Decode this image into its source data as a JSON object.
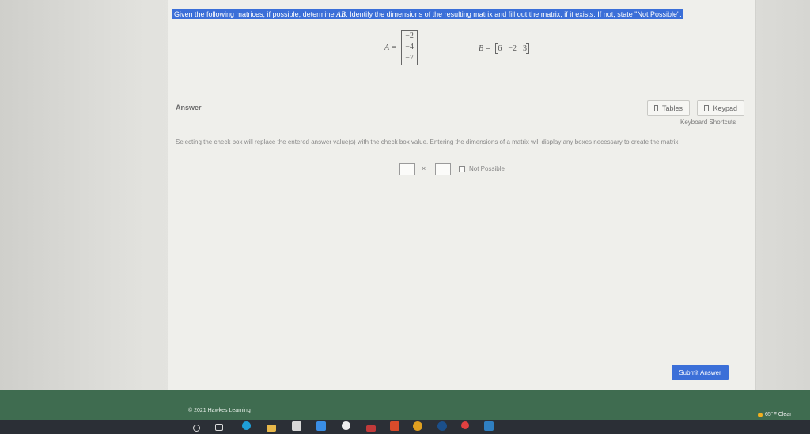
{
  "question": {
    "prefix": "Given the following matrices, if possible, determine ",
    "math": "AB",
    "suffix": ". Identify the dimensions of the resulting matrix and fill out the matrix, if it exists. If not, state \"Not Possible\"."
  },
  "matrix_a": {
    "label": "A =",
    "entries": [
      "−2",
      "−4",
      "−7"
    ]
  },
  "matrix_b": {
    "label": "B =",
    "entries": [
      "6",
      "−2",
      "3"
    ]
  },
  "answer": {
    "label": "Answer",
    "tables_label": "Tables",
    "keypad_label": "Keypad",
    "shortcuts_label": "Keyboard Shortcuts",
    "instructions": "Selecting the check box will replace the entered answer value(s) with the check box value. Entering the dimensions of a matrix will display any boxes necessary to create the matrix.",
    "times_symbol": "×",
    "not_possible_label": "Not Possible",
    "submit_label": "Submit Answer"
  },
  "footer": {
    "copyright": "© 2021 Hawkes Learning"
  },
  "system": {
    "weather": "65°F Clear"
  },
  "colors": {
    "accent": "#3b6fd8",
    "footer": "#3f6c50",
    "taskbar": "#2b2f36"
  },
  "taskbar_icons": [
    "search-icon",
    "task-view-icon",
    "edge-icon",
    "file-explorer-icon",
    "store-icon",
    "mail-icon",
    "xbox-icon",
    "photos-icon",
    "office-icon",
    "chrome-icon",
    "steam-icon",
    "maps-icon",
    "app-icon"
  ]
}
